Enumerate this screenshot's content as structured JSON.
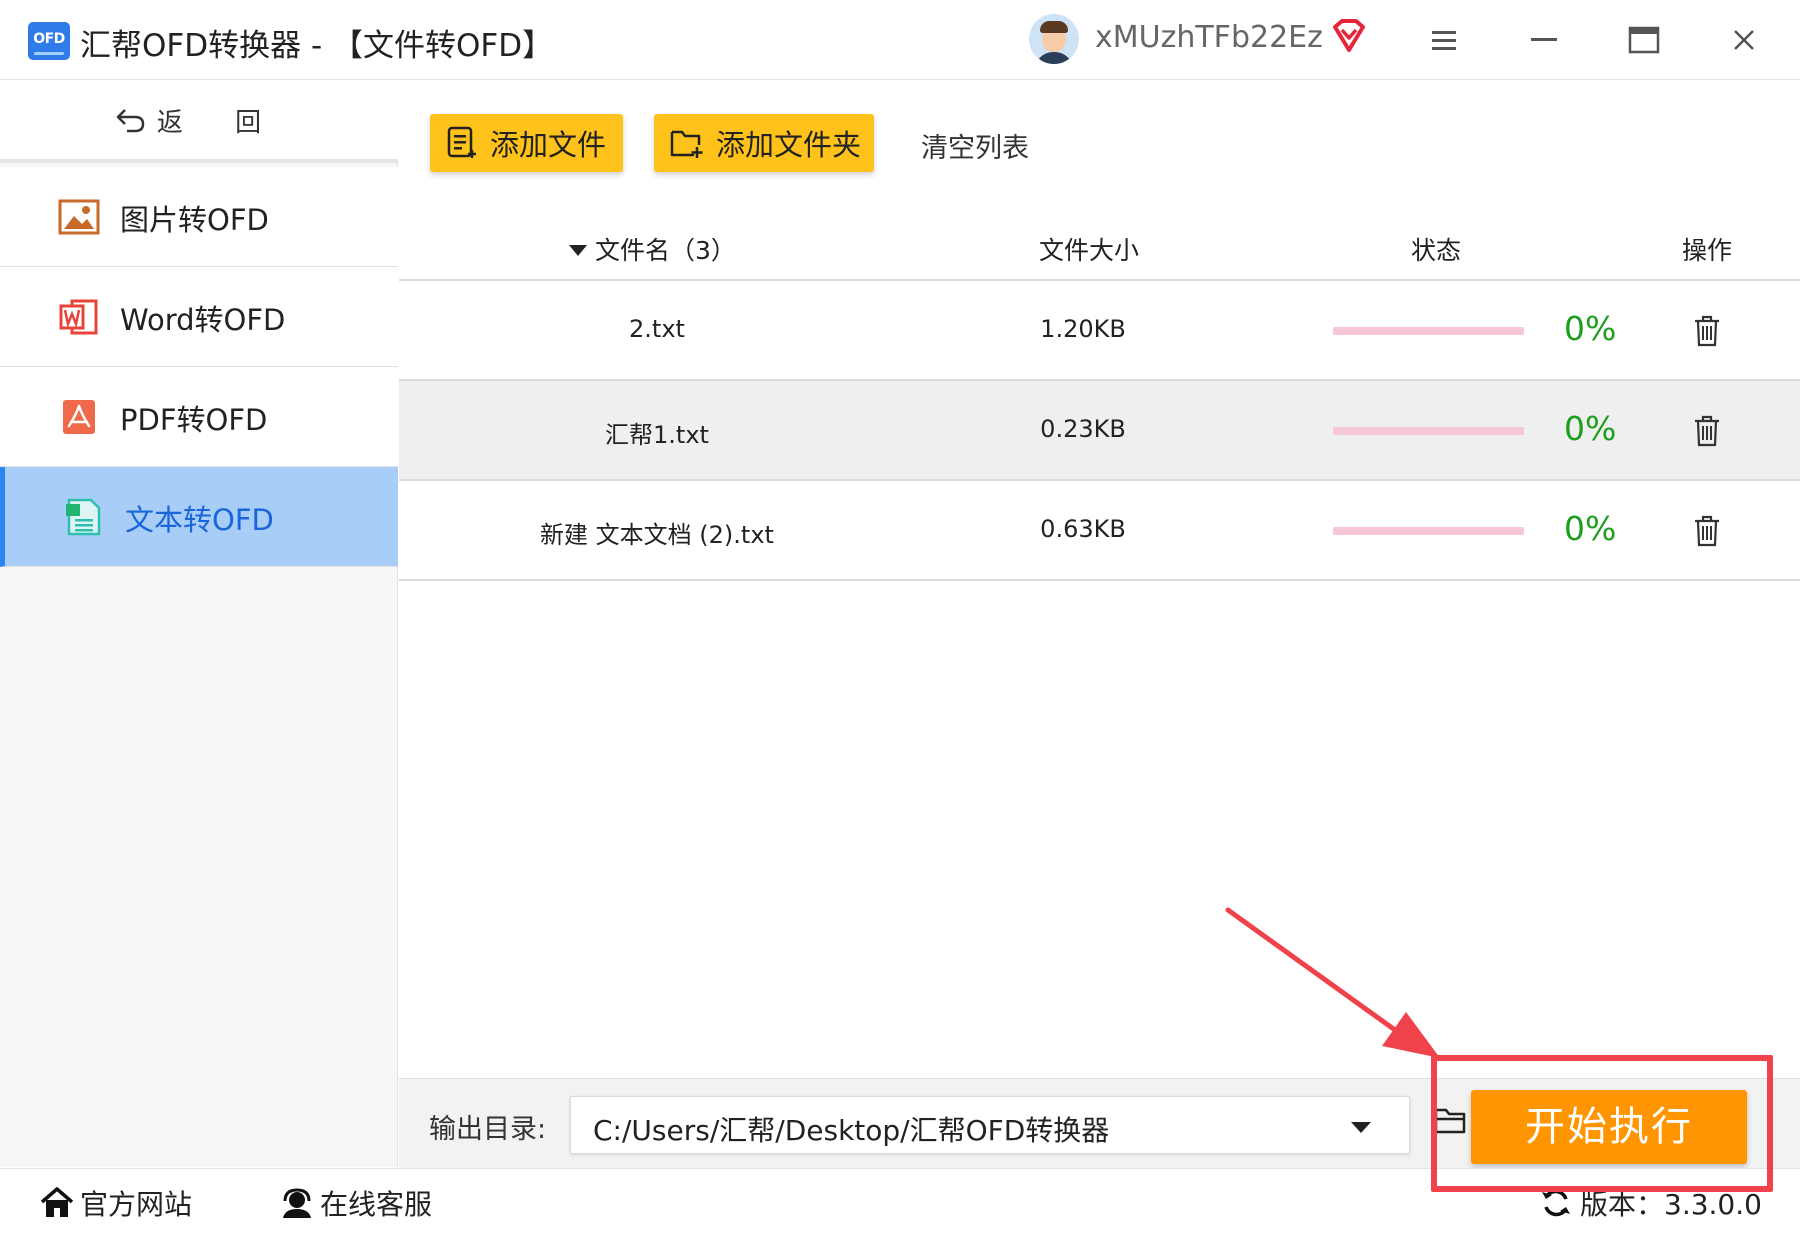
{
  "window": {
    "logo_text": "OFD",
    "title": "汇帮OFD转换器 - 【文件转OFD】",
    "username": "xMUzhTFb22Ez",
    "icons": {
      "vip": "diamond-icon",
      "menu": "hamburger-menu-icon",
      "minimize": "minimize-icon",
      "maximize": "maximize-icon",
      "close": "close-icon"
    }
  },
  "sidebar": {
    "back_label": "返 回",
    "items": [
      {
        "label": "图片转OFD",
        "icon": "image-icon",
        "active": false
      },
      {
        "label": "Word转OFD",
        "icon": "word-icon",
        "active": false
      },
      {
        "label": "PDF转OFD",
        "icon": "pdf-icon",
        "active": false
      },
      {
        "label": "文本转OFD",
        "icon": "text-file-icon",
        "active": true
      }
    ]
  },
  "toolbar": {
    "add_file": "添加文件",
    "add_folder": "添加文件夹",
    "clear_list": "清空列表"
  },
  "table": {
    "headers": {
      "name": "文件名（3）",
      "size": "文件大小",
      "status": "状态",
      "action": "操作"
    },
    "rows": [
      {
        "name": "2.txt",
        "size": "1.20KB",
        "progress": 0,
        "percent": "0%"
      },
      {
        "name": "汇帮1.txt",
        "size": "0.23KB",
        "progress": 0,
        "percent": "0%"
      },
      {
        "name": "新建 文本文档 (2).txt",
        "size": "0.63KB",
        "progress": 0,
        "percent": "0%"
      }
    ]
  },
  "output": {
    "label": "输出目录:",
    "path": "C:/Users/汇帮/Desktop/汇帮OFD转换器",
    "start_button": "开始执行"
  },
  "footer": {
    "website": "官方网站",
    "service": "在线客服",
    "version": "版本：3.3.0.0"
  },
  "colors": {
    "accent_yellow": "#ffc21a",
    "start_orange": "#ff9500",
    "active_nav_bg": "#a8cdf7",
    "active_nav_text": "#1a66d9",
    "percent_green": "#1e9e1e",
    "annotation_red": "#f0424a"
  }
}
